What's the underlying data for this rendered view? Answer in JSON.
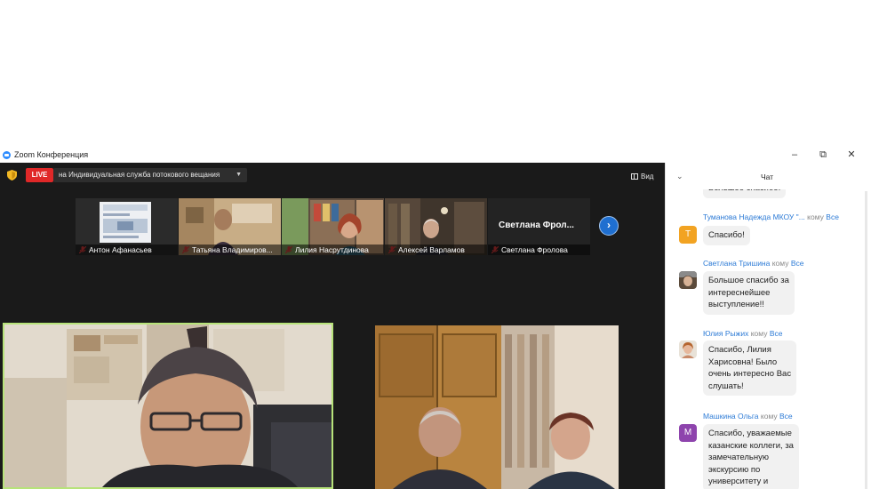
{
  "window": {
    "title": "Zoom Конференция",
    "minimize_glyph": "–",
    "restore_glyph": "⧉",
    "close_glyph": "✕"
  },
  "toolbar": {
    "live_label": "LIVE",
    "stream_label": "на Индивидуальная служба потокового вещания",
    "view_label": "Вид"
  },
  "thumbnails": [
    {
      "name": "Антон Афанасьев"
    },
    {
      "name": "Татьяна Владимиров..."
    },
    {
      "name": "Лилия Насрутдинова"
    },
    {
      "name": "Алексей Варламов"
    },
    {
      "name": "Светлана Фролова",
      "display_name": "Светлана Фрол..."
    }
  ],
  "next_button_glyph": "›",
  "chat": {
    "title": "Чат",
    "partial_top": "Большое спасибо!",
    "messages": [
      {
        "sender": "Туманова Надежда МКОУ \"...",
        "to_label": "кому",
        "to": "Все",
        "avatar_letter": "Т",
        "avatar_color": "#f2a322",
        "lines": [
          "Спасибо!"
        ]
      },
      {
        "sender": "Светлана Тришина",
        "to_label": "кому",
        "to": "Все",
        "lines": [
          "Большое спасибо за",
          "интереснейшее",
          "выступление!!"
        ]
      },
      {
        "sender": "Юлия Рыжих",
        "to_label": "кому",
        "to": "Все",
        "lines": [
          "Спасибо, Лилия",
          "Харисовна! Было",
          "очень интересно Вас",
          "слушать!"
        ]
      },
      {
        "sender": "Машкина Ольга",
        "to_label": "кому",
        "to": "Все",
        "avatar_letter": "М",
        "avatar_color": "#8e44ad",
        "lines": [
          "Спасибо, уважаемые",
          "казанские коллеги, за",
          "замечательную",
          "экскурсию  по",
          "университету и"
        ]
      }
    ]
  },
  "colors": {
    "live_red": "#e02828",
    "active_speaker_border": "#b7e37a",
    "chat_link_blue": "#2d7bd6",
    "next_button_blue": "#1f6fd0"
  }
}
